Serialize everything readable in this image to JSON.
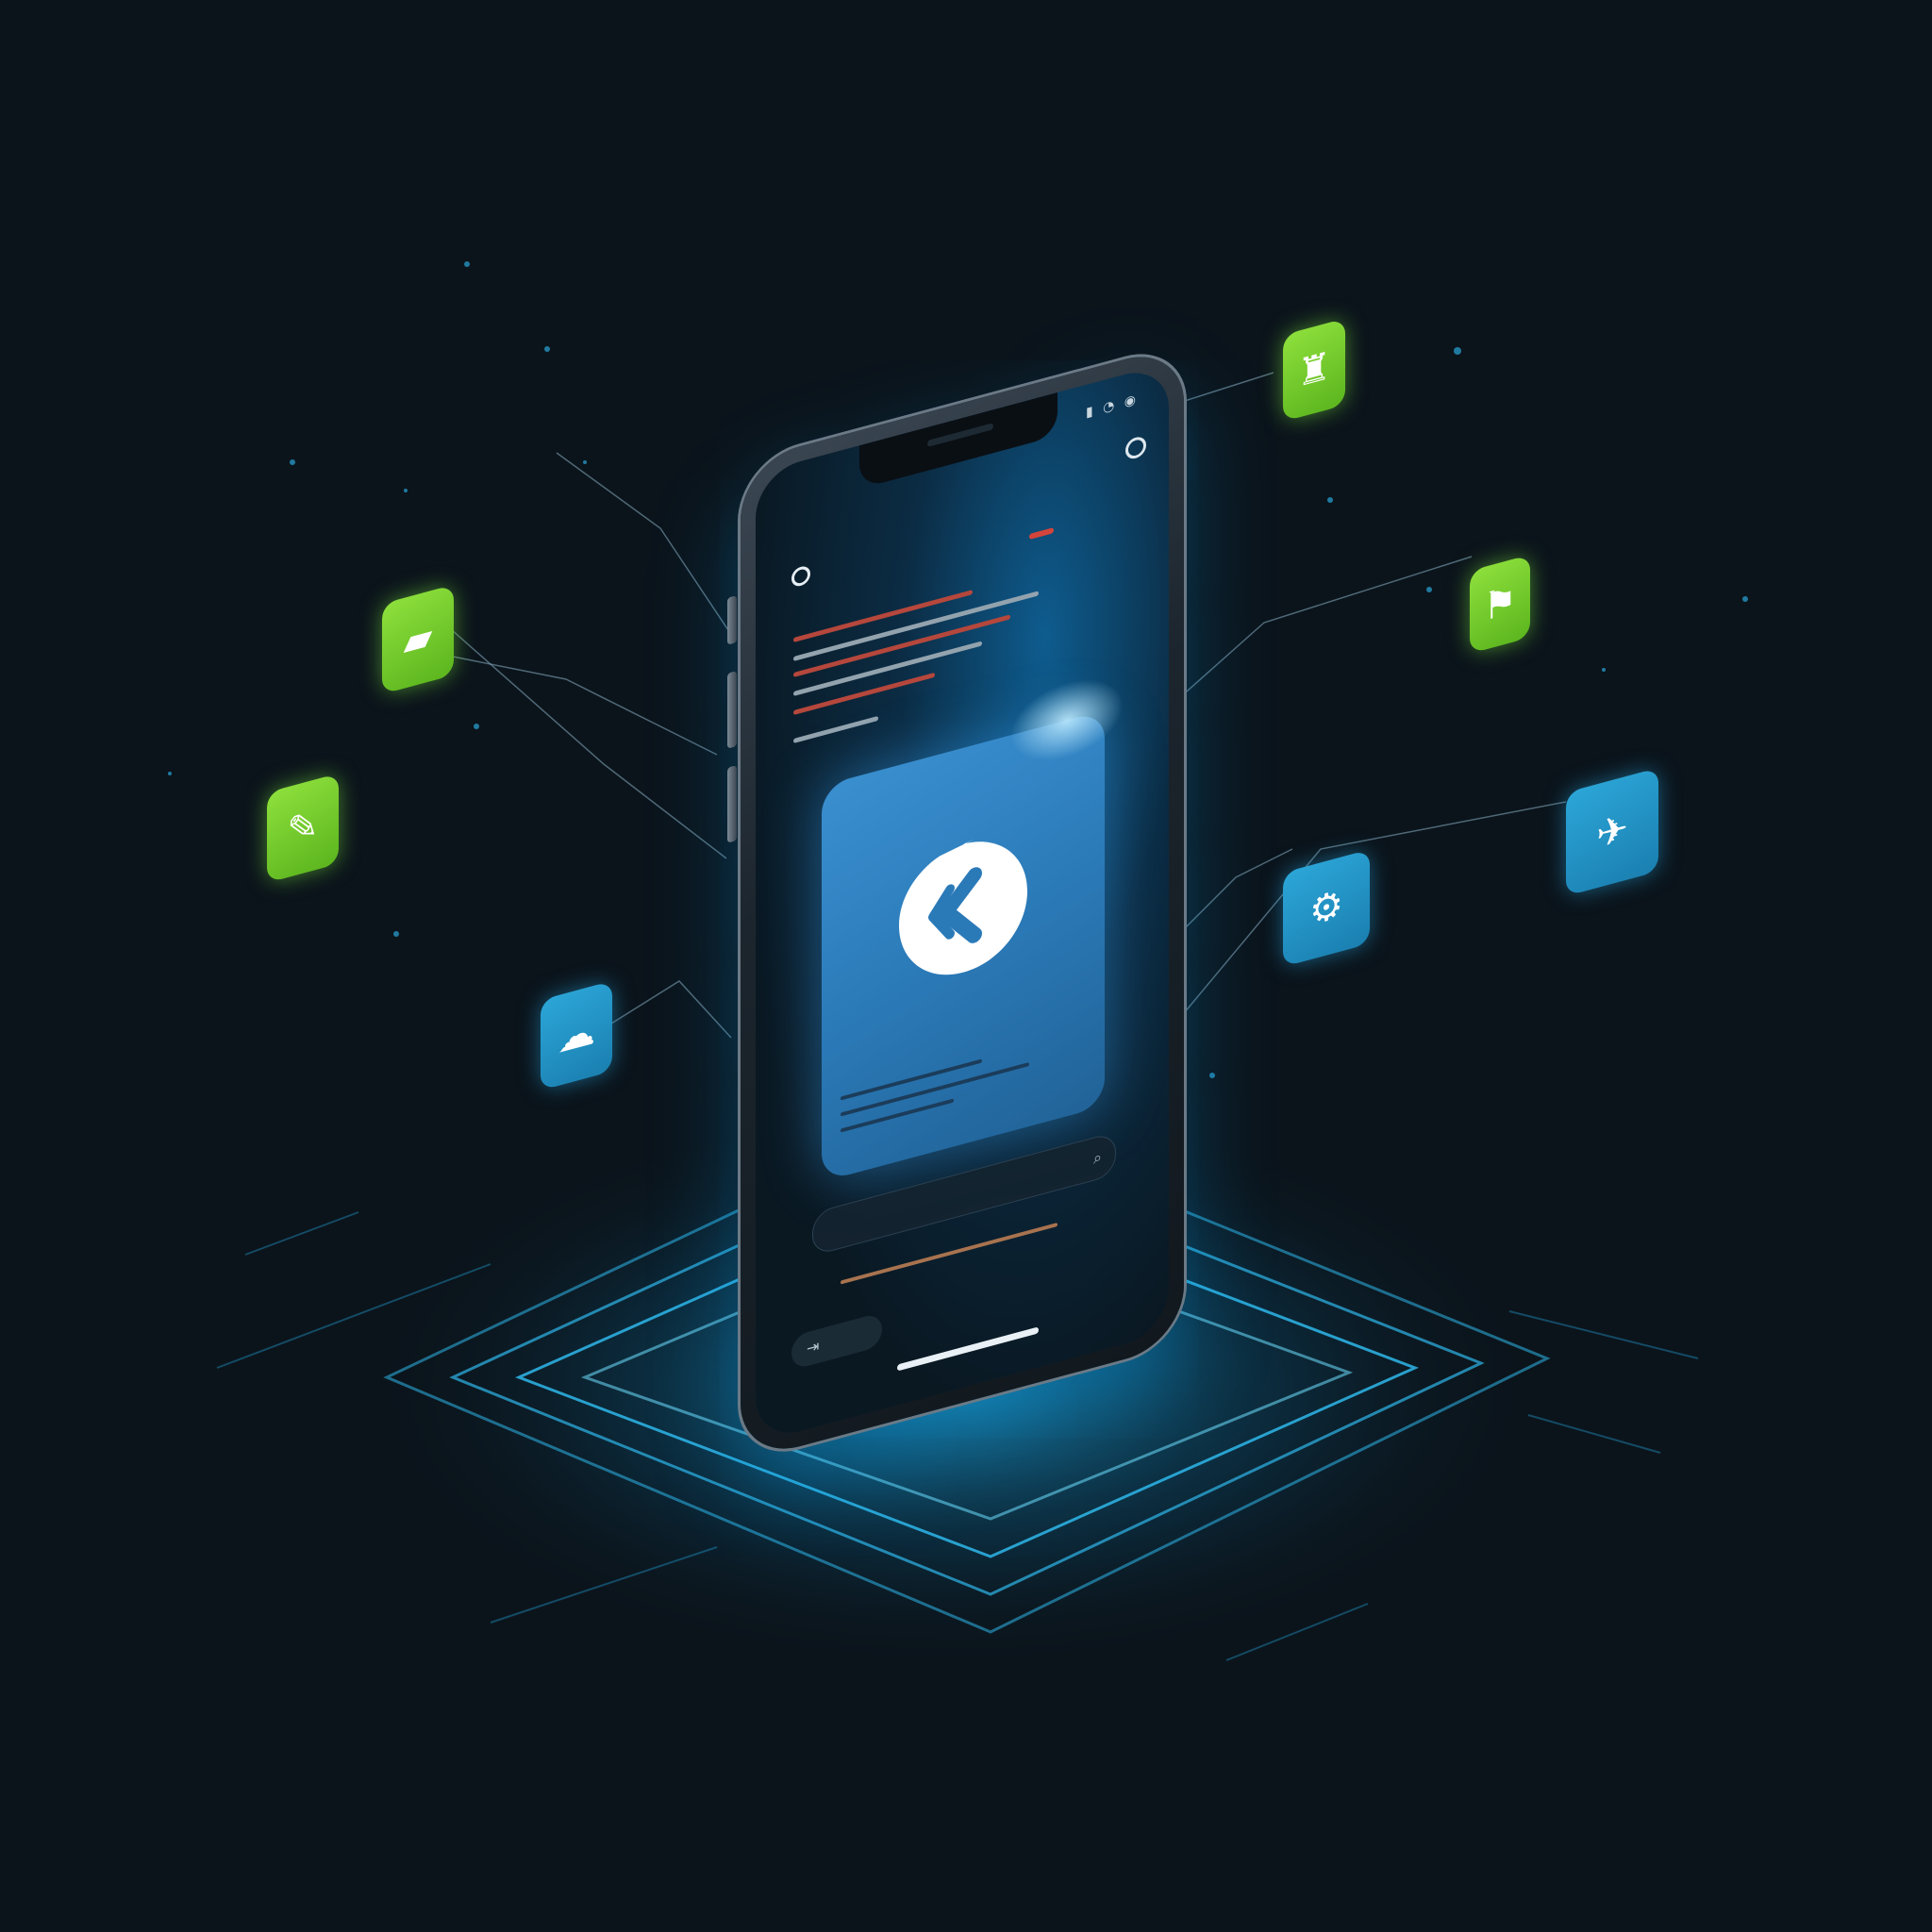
{
  "phone": {
    "clock": "",
    "status_icons": "▮ ◔ ◉",
    "title": "",
    "search_icon_glyph": "⌕",
    "bottom_icon_glyph": "⇥"
  },
  "floating_icons": [
    {
      "name": "green-app-icon-1",
      "color": "green",
      "glyph": "▰"
    },
    {
      "name": "green-app-icon-2",
      "color": "green",
      "glyph": "✎"
    },
    {
      "name": "blue-app-icon-1",
      "color": "blue",
      "glyph": "☁"
    },
    {
      "name": "green-app-icon-3",
      "color": "green",
      "glyph": "♜"
    },
    {
      "name": "green-app-icon-4",
      "color": "green",
      "glyph": "⚑"
    },
    {
      "name": "blue-app-icon-2",
      "color": "blue",
      "glyph": "⚙"
    },
    {
      "name": "blue-app-icon-3",
      "color": "blue",
      "glyph": "✈"
    }
  ],
  "colors": {
    "background": "#0b141b",
    "accent_blue": "#2b7ab8",
    "accent_green": "#6cc62a",
    "glow": "#27c3ff"
  }
}
